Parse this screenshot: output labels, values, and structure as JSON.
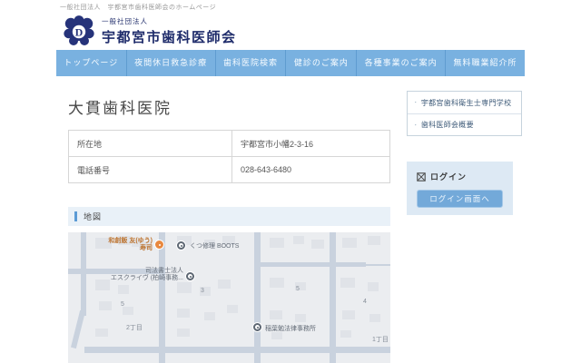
{
  "header": {
    "tagline": "一般社団法人　宇都宮市歯科医師会のホームページ",
    "org_type": "一般社団法人",
    "org_name": "宇都宮市歯科医師会",
    "logo_letter": "D"
  },
  "nav": {
    "items": [
      "トップページ",
      "夜間休日救急診療",
      "歯科医院検索",
      "健診のご案内",
      "各種事業のご案内",
      "無料職業紹介所"
    ]
  },
  "main": {
    "title": "大貫歯科医院",
    "info": [
      {
        "label": "所在地",
        "value": "宇都宮市小幡2-3-16"
      },
      {
        "label": "電話番号",
        "value": "028-643-6480"
      }
    ],
    "map": {
      "heading": "地図",
      "pois": {
        "restaurant_name": "和創飯 友(ゆう)",
        "restaurant_sub": "寿司",
        "shoe_repair": "くつ修理 BOOTS",
        "law_office_1a": "司法書士法人",
        "law_office_1b": "エスクライヴ (柏崎事務...",
        "law_office_2": "稲葉勉法律事務所",
        "block_3": "3",
        "block_5a": "5",
        "block_5b": "5",
        "block_4": "4",
        "chome_2": "2丁目",
        "chome_1": "1丁目"
      }
    }
  },
  "sidebar": {
    "links": [
      {
        "label": "宇都宮歯科衛生士専門学校"
      },
      {
        "label": "歯科医師会概要"
      }
    ],
    "login": {
      "title": "ログイン",
      "button_label": "ログイン画面へ"
    }
  },
  "colors": {
    "nav_blue": "#79b1e0",
    "navy": "#1f2c6b",
    "accent_blue": "#5b9bd5",
    "login_bg": "#dde9f4",
    "button_blue": "#73a9d9",
    "map_marker_orange": "#e8883e"
  }
}
